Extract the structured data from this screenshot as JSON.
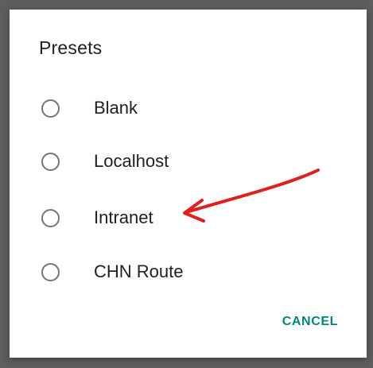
{
  "dialog": {
    "title": "Presets",
    "options": [
      {
        "label": "Blank",
        "selected": false
      },
      {
        "label": "Localhost",
        "selected": false
      },
      {
        "label": "Intranet",
        "selected": false
      },
      {
        "label": "CHN Route",
        "selected": false
      }
    ],
    "cancel_label": "CANCEL"
  },
  "colors": {
    "accent": "#00897b",
    "annotation_arrow": "#e0201b",
    "backdrop": "#5e5e5e"
  },
  "annotation": {
    "type": "arrow",
    "points_to": "Intranet"
  }
}
